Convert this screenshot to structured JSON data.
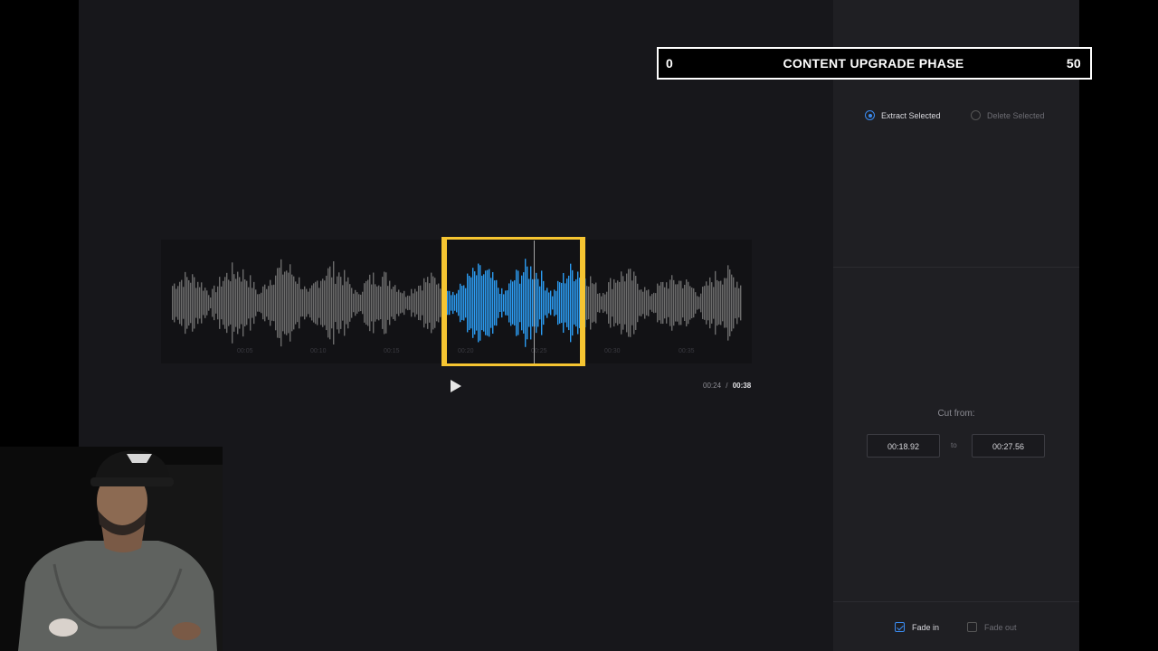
{
  "banner": {
    "left_value": "0",
    "title": "CONTENT UPGRADE PHASE",
    "right_value": "50"
  },
  "mode_options": [
    {
      "label": "Extract Selected",
      "selected": true
    },
    {
      "label": "Delete Selected",
      "selected": false
    }
  ],
  "waveform": {
    "tick_labels": [
      "00:05",
      "00:10",
      "00:15",
      "00:20",
      "00:25",
      "00:30",
      "00:35"
    ],
    "colors": {
      "unselected": "#6b6b6b",
      "selected": "#2b9bf0",
      "handle": "#f6c531"
    }
  },
  "playback": {
    "current_time": "00:24",
    "separator": "/",
    "total_time": "00:38",
    "play_icon": "play-icon"
  },
  "cut": {
    "label": "Cut from:",
    "start": "00:18.92",
    "to_label": "to",
    "end": "00:27.56"
  },
  "fade_options": [
    {
      "label": "Fade in",
      "checked": true
    },
    {
      "label": "Fade out",
      "checked": false
    }
  ],
  "accent_color": "#3b8cf2"
}
